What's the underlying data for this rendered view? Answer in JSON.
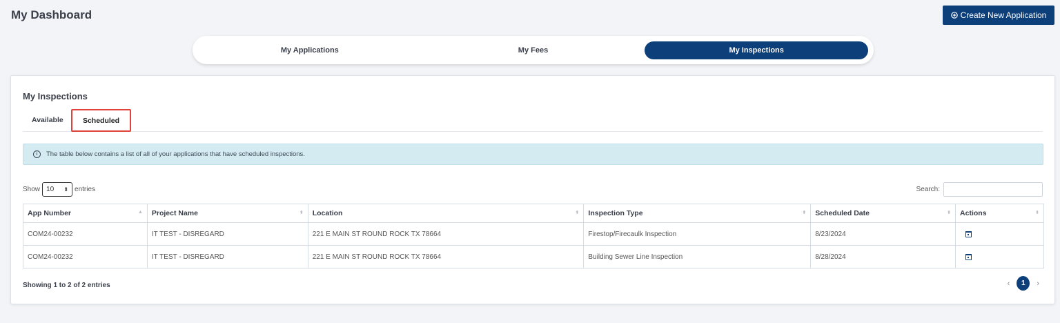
{
  "page_title": "My Dashboard",
  "header": {
    "create_button_label": "Create New Application",
    "create_button_icon": "plus-circle-icon"
  },
  "nav_tabs": [
    {
      "label": "My Applications",
      "active": false
    },
    {
      "label": "My Fees",
      "active": false
    },
    {
      "label": "My Inspections",
      "active": true
    }
  ],
  "card": {
    "title": "My Inspections",
    "sub_tabs": [
      {
        "label": "Available",
        "active": false
      },
      {
        "label": "Scheduled",
        "active": true,
        "highlighted": true
      }
    ],
    "info_message": "The table below contains a list of all of your applications that have scheduled inspections.",
    "info_icon": "info-circle-icon",
    "length": {
      "prefix": "Show",
      "value": "10",
      "suffix": "entries"
    },
    "search_label": "Search:",
    "search_value": ""
  },
  "table": {
    "columns": [
      "App Number",
      "Project Name",
      "Location",
      "Inspection Type",
      "Scheduled Date",
      "Actions"
    ],
    "rows": [
      {
        "app_number": "COM24-00232",
        "project_name": "IT TEST - DISREGARD",
        "location": "221 E MAIN ST ROUND ROCK TX 78664",
        "inspection_type": "Firestop/Firecaulk Inspection",
        "scheduled_date": "8/23/2024",
        "action_icon": "calendar-icon"
      },
      {
        "app_number": "COM24-00232",
        "project_name": "IT TEST - DISREGARD",
        "location": "221 E MAIN ST ROUND ROCK TX 78664",
        "inspection_type": "Building Sewer Line Inspection",
        "scheduled_date": "8/28/2024",
        "action_icon": "calendar-icon"
      }
    ]
  },
  "footer": {
    "info": "Showing 1 to 2 of 2 entries",
    "prev": "‹",
    "current_page": "1",
    "next": "›"
  },
  "colors": {
    "primary": "#0d3f7a",
    "highlight_border": "#e0413b",
    "info_bg": "#d4ebf2",
    "page_bg": "#f3f4f7"
  }
}
